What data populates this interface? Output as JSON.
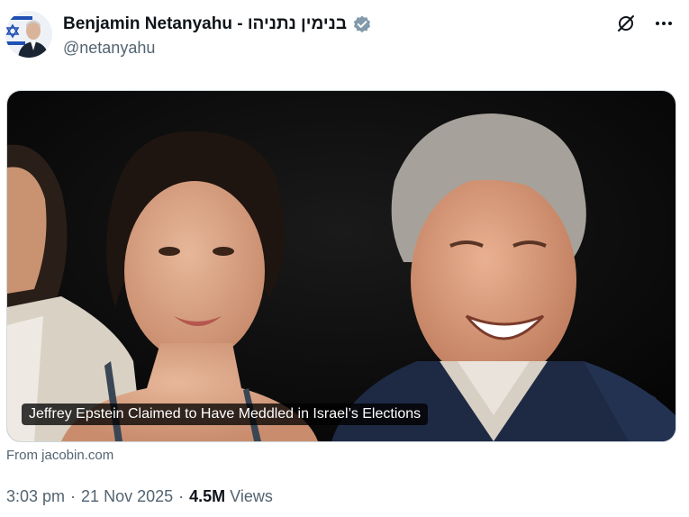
{
  "post": {
    "author": {
      "display_name": "Benjamin Netanyahu - בנימין נתניהו",
      "handle": "@netanyahu",
      "verified_color": "#829aab"
    },
    "actions": {
      "grok_icon": "grok-icon",
      "more_icon": "more-icon"
    },
    "card": {
      "title": "Jeffrey Epstein Claimed to Have Meddled in Israel’s Elections",
      "source": "From jacobin.com"
    },
    "meta": {
      "time": "3:03 pm",
      "date": "21 Nov 2025",
      "separator": "·",
      "views_count": "4.5M",
      "views_label": "Views"
    }
  }
}
